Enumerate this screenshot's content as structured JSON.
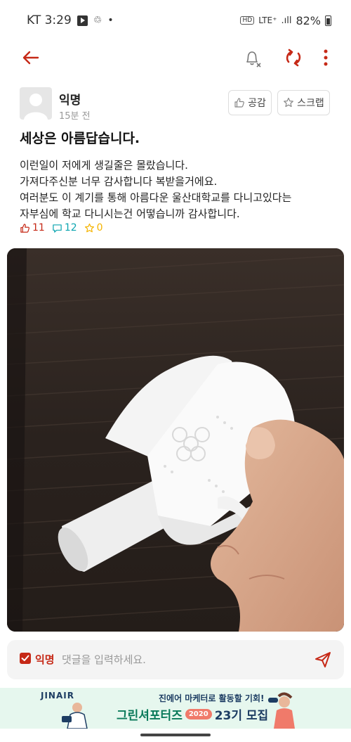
{
  "status_bar": {
    "carrier_time": "KT 3:29",
    "hd": "HD",
    "network": "LTE⁺",
    "battery": "82%"
  },
  "app_bar": {
    "icons": [
      "back-arrow-icon",
      "bell-off-icon",
      "refresh-icon",
      "more-vertical-icon"
    ],
    "accent_color": "#c62917"
  },
  "post": {
    "author": "익명",
    "time": "15분 전",
    "like_button": "공감",
    "scrap_button": "스크랩",
    "title": "세상은 아름답습니다.",
    "body": [
      "이런일이 저에게 생길줄은 몰랐습니다.",
      "가져다주신분 너무 감사합니다 복받을거에요.",
      "여러분도 이 계기를 통해 아름다운 울산대학교를 다니고있다는",
      "자부심에 학교 다니시는건 어떻습니까 감사합니다."
    ],
    "likes": "11",
    "comments": "12",
    "scraps": "0"
  },
  "comment_bar": {
    "anonymous_label": "익명",
    "placeholder": "댓글을 입력하세요."
  },
  "ad": {
    "brand": "JINAIR",
    "headline": "진에어 마케터로 활동할 기회!",
    "title": "그린셔포터즈",
    "year": "2020",
    "cohort": "23기 모집"
  }
}
